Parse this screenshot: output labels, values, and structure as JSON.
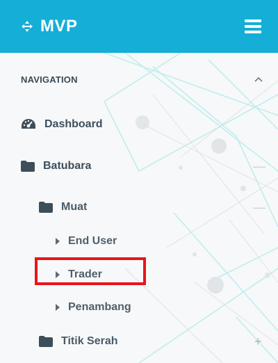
{
  "app": {
    "title": "MVP",
    "brand_color": "#14aed6"
  },
  "topbar": {
    "brand_icon": "crosshair-arrows-icon",
    "menu_icon": "hamburger-icon"
  },
  "sidebar": {
    "section_header": "NAVIGATION",
    "collapse_icon": "chevron-up-icon",
    "items": [
      {
        "label": "Dashboard",
        "icon": "dashboard-gauge-icon"
      },
      {
        "label": "Batubara",
        "icon": "folder-icon",
        "expand_icon": "minus-icon"
      },
      {
        "label": "Muat",
        "icon": "folder-icon",
        "expand_icon": "minus-icon"
      },
      {
        "label": "End User",
        "icon": "caret-right-icon"
      },
      {
        "label": "Trader",
        "icon": "caret-right-icon",
        "highlighted": true
      },
      {
        "label": "Penambang",
        "icon": "caret-right-icon"
      },
      {
        "label": "Titik Serah",
        "icon": "folder-icon",
        "expand_icon": "plus-icon"
      }
    ],
    "expand_symbols": {
      "minus": "—",
      "plus": "+"
    }
  },
  "colors": {
    "highlight_border": "#e8141b",
    "text": "#3d4e5b"
  }
}
